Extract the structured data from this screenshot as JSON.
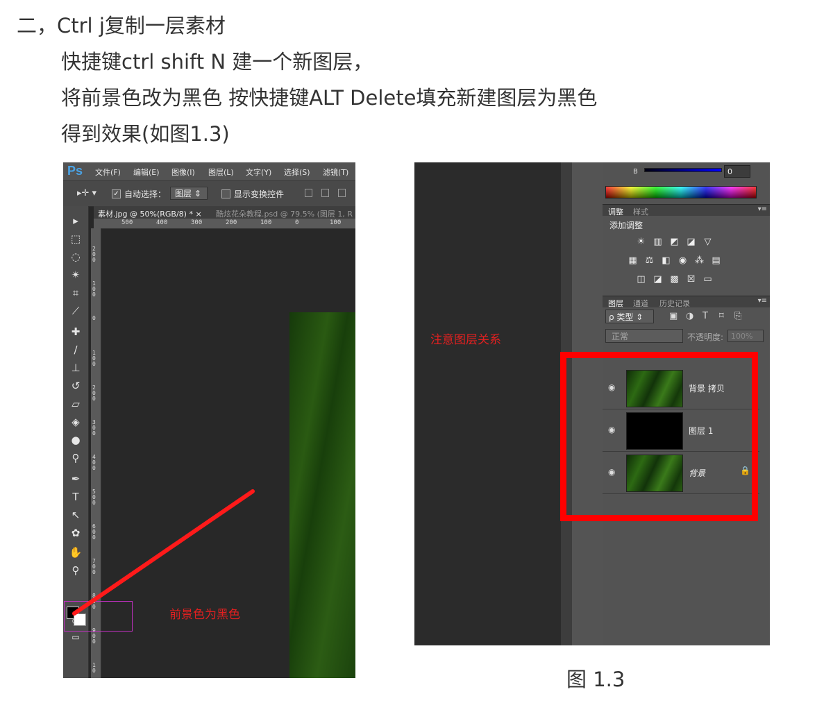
{
  "text": {
    "line1": "二，Ctrl  j复制一层素材",
    "line2": "快捷键ctrl  shift  N 建一个新图层，",
    "line3": "将前景色改为黑色  按快捷键ALT  Delete填充新建图层为黑色",
    "line4": "得到效果(如图1.3)",
    "caption": "图  1.3"
  },
  "left_screenshot": {
    "logo": "Ps",
    "menu": [
      "文件(F)",
      "编辑(E)",
      "图像(I)",
      "图层(L)",
      "文字(Y)",
      "选择(S)",
      "滤镜(T)"
    ],
    "options": {
      "auto_select_label": "自动选择：",
      "auto_select_value": "图层",
      "show_transform_label": "显示变换控件"
    },
    "tabs": {
      "active": "素材.jpg @ 50%(RGB/8) *",
      "close": "×",
      "inactive": "酷炫花朵教程.psd @ 79.5% (图层 1, R"
    },
    "ruler_h": [
      "500",
      "400",
      "300",
      "200",
      "100",
      "0",
      "100"
    ],
    "ruler_v": [
      "2 0 0",
      "1 0 0",
      "0",
      "1 0 0",
      "2 0 0",
      "3 0 0",
      "4 0 0",
      "5 0 0",
      "6 0 0",
      "7 0 0",
      "8 0 0",
      "9 0 0",
      "1 0"
    ],
    "annotation": "前景色为黑色",
    "annotation_color": "#e02020",
    "foreground_color": "#000000",
    "background_color": "#ffffff"
  },
  "right_screenshot": {
    "color_label": "B",
    "color_value": "0",
    "panel_tabs_top": [
      "调整",
      "样式"
    ],
    "add_adjustment": "添加调整",
    "panel_tabs_layers": [
      "图层",
      "通道",
      "历史记录"
    ],
    "filter_type": "ρ 类型",
    "blend_mode": "正常",
    "opacity_label": "不透明度:",
    "opacity_value": "100%",
    "layers": [
      {
        "name": "背景 拷贝",
        "thumb": "green",
        "italic": false,
        "locked": false
      },
      {
        "name": "图层 1",
        "thumb": "black",
        "italic": false,
        "locked": false
      },
      {
        "name": "背景",
        "thumb": "green",
        "italic": true,
        "locked": true
      }
    ],
    "annotation": "注意图层关系",
    "highlight_color": "#ff0000"
  }
}
